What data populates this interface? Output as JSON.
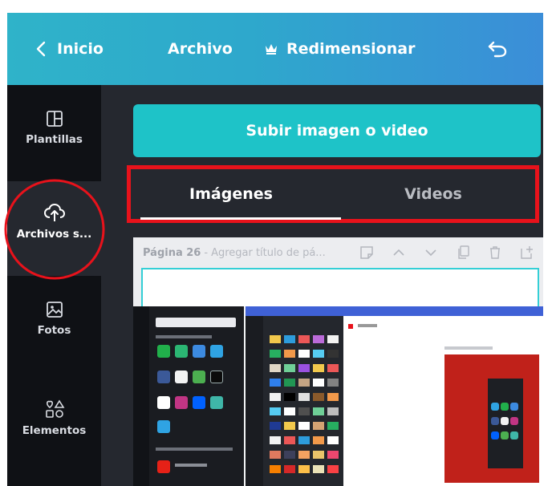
{
  "header": {
    "back_label": "Inicio",
    "file_label": "Archivo",
    "resize_label": "Redimensionar",
    "colors": {
      "gradient_start": "#2fb3c9",
      "gradient_end": "#3b8ed8"
    }
  },
  "sidebar": {
    "items": [
      {
        "label": "Plantillas",
        "icon": "templates-icon"
      },
      {
        "label": "Archivos s...",
        "icon": "cloud-upload-icon",
        "active": true
      },
      {
        "label": "Fotos",
        "icon": "photo-icon"
      },
      {
        "label": "Elementos",
        "icon": "shapes-icon"
      }
    ]
  },
  "panel": {
    "upload_button": "Subir imagen o video",
    "tabs": [
      {
        "label": "Imágenes",
        "selected": true
      },
      {
        "label": "Videos",
        "selected": false
      }
    ],
    "page_number": "Página 26",
    "page_title_placeholder": "Agregar título de pá...",
    "accent_color": "#1ec3c8"
  }
}
